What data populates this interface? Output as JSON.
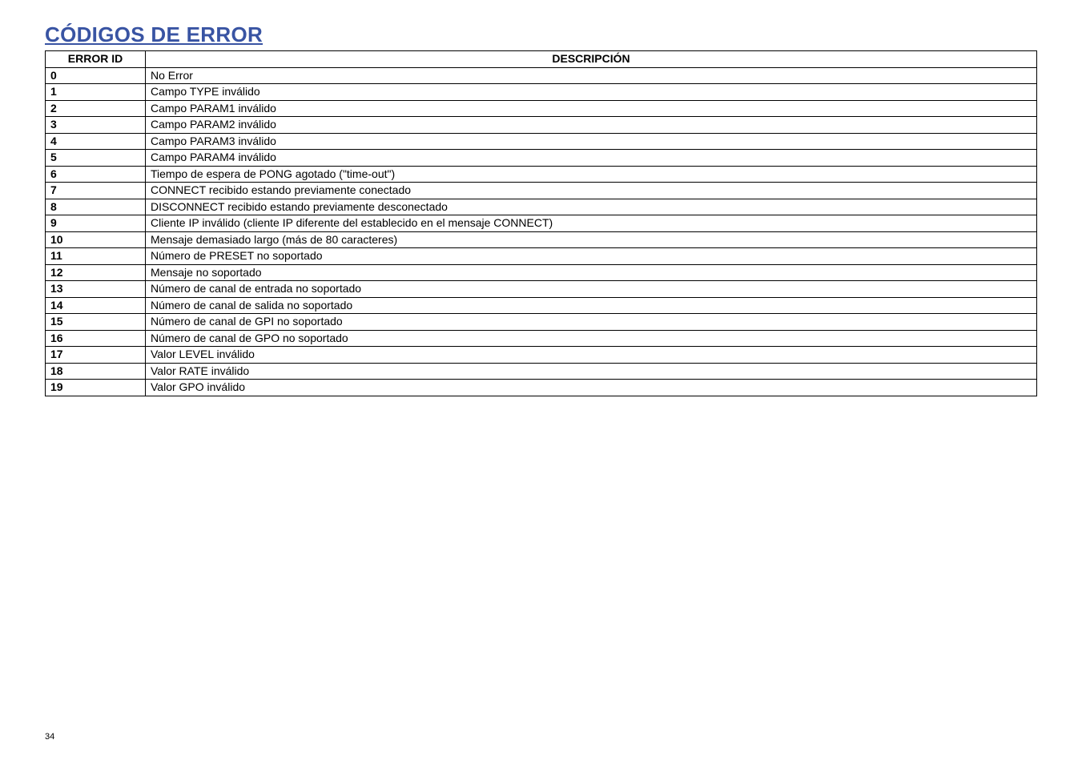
{
  "title": "CÓDIGOS DE ERROR",
  "table": {
    "headers": {
      "id": "ERROR ID",
      "desc": "DESCRIPCIÓN"
    },
    "rows": [
      {
        "id": "0",
        "desc": "No Error"
      },
      {
        "id": "1",
        "desc": "Campo TYPE inválido"
      },
      {
        "id": "2",
        "desc": "Campo PARAM1 inválido"
      },
      {
        "id": "3",
        "desc": "Campo PARAM2 inválido"
      },
      {
        "id": "4",
        "desc": "Campo PARAM3 inválido"
      },
      {
        "id": "5",
        "desc": "Campo PARAM4 inválido"
      },
      {
        "id": "6",
        "desc": "Tiempo de espera de PONG agotado (\"time-out\")"
      },
      {
        "id": "7",
        "desc": "CONNECT recibido estando previamente conectado"
      },
      {
        "id": "8",
        "desc": "DISCONNECT recibido estando previamente desconectado"
      },
      {
        "id": "9",
        "desc": "Cliente IP inválido (cliente IP diferente del establecido en el mensaje CONNECT)"
      },
      {
        "id": "10",
        "desc": "Mensaje demasiado largo (más de 80 caracteres)"
      },
      {
        "id": "11",
        "desc": "Número de PRESET no soportado"
      },
      {
        "id": "12",
        "desc": "Mensaje no soportado"
      },
      {
        "id": "13",
        "desc": "Número de canal de entrada no soportado"
      },
      {
        "id": "14",
        "desc": "Número de canal de salida no soportado"
      },
      {
        "id": "15",
        "desc": "Número de canal de GPI no soportado"
      },
      {
        "id": "16",
        "desc": "Número de canal de GPO no soportado"
      },
      {
        "id": "17",
        "desc": "Valor LEVEL inválido"
      },
      {
        "id": "18",
        "desc": "Valor RATE inválido"
      },
      {
        "id": "19",
        "desc": "Valor GPO inválido"
      }
    ]
  },
  "page_number": "34"
}
